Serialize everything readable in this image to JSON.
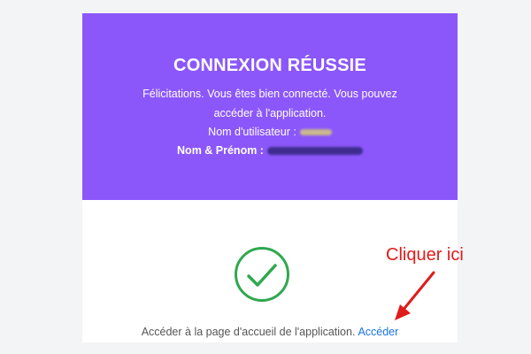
{
  "banner": {
    "title": "CONNEXION RÉUSSIE",
    "line1": "Félicitations. Vous êtes bien connecté. Vous pouvez",
    "line2": "accéder à l'application.",
    "username_label": "Nom d'utilisateur :",
    "fullname_label": "Nom & Prénom :"
  },
  "success_icon": "checkmark-circle-icon",
  "footer": {
    "text": "Accéder à la page d'accueil de l'application.",
    "link": "Accéder"
  },
  "annotation": {
    "text": "Cliquer ici",
    "icon": "arrow-icon"
  },
  "colors": {
    "banner": "#8b57fb",
    "success": "#2fa84f",
    "link": "#1a73e8",
    "annotation": "#e01b1b"
  }
}
